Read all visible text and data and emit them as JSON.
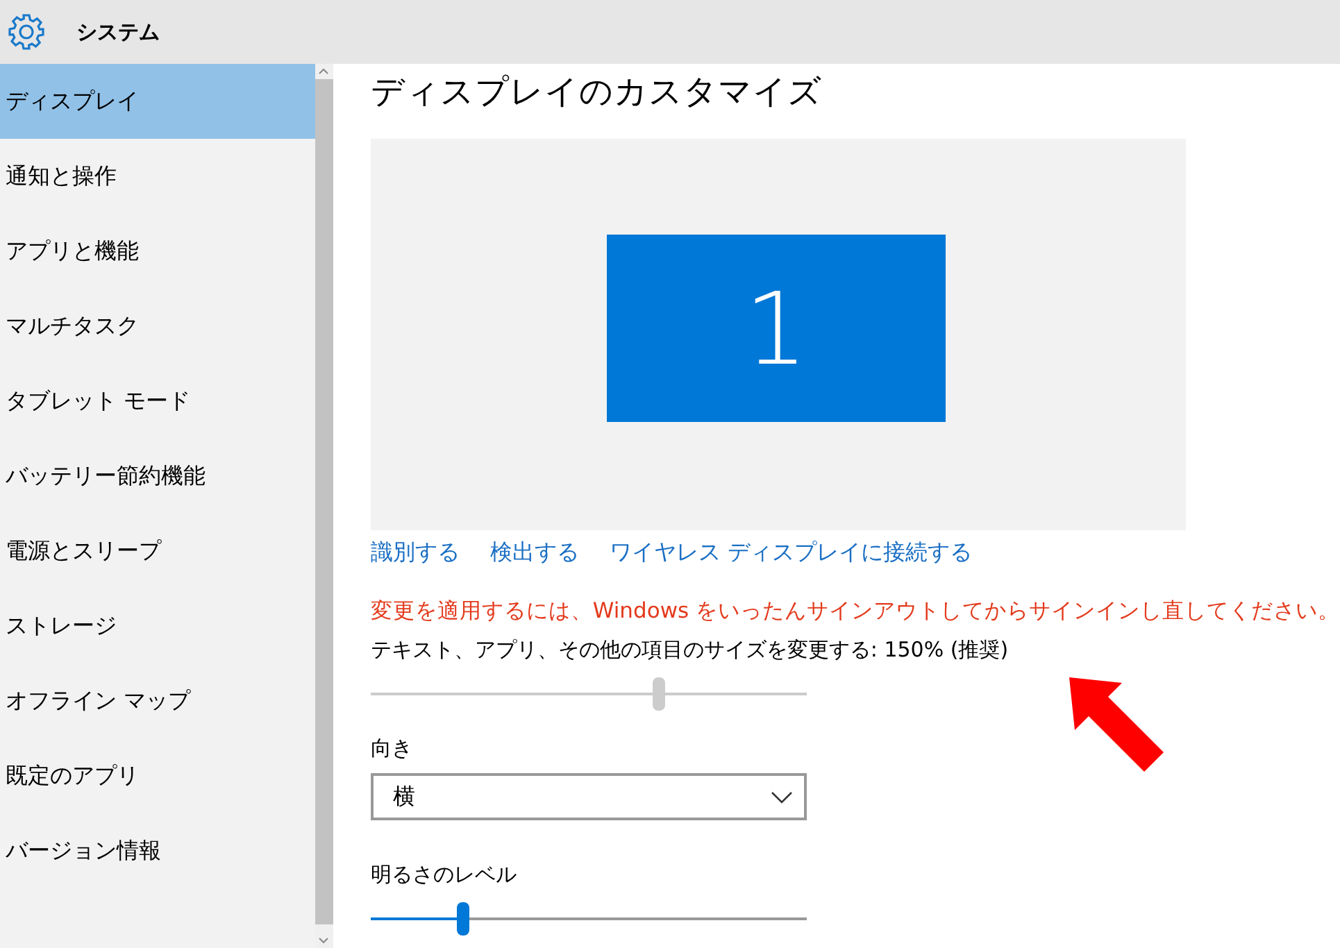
{
  "header": {
    "title": "システム"
  },
  "sidebar": {
    "items": [
      {
        "label": "ディスプレイ",
        "selected": true
      },
      {
        "label": "通知と操作",
        "selected": false
      },
      {
        "label": "アプリと機能",
        "selected": false
      },
      {
        "label": "マルチタスク",
        "selected": false
      },
      {
        "label": "タブレット モード",
        "selected": false
      },
      {
        "label": "バッテリー節約機能",
        "selected": false
      },
      {
        "label": "電源とスリープ",
        "selected": false
      },
      {
        "label": "ストレージ",
        "selected": false
      },
      {
        "label": "オフライン マップ",
        "selected": false
      },
      {
        "label": "既定のアプリ",
        "selected": false
      },
      {
        "label": "バージョン情報",
        "selected": false
      }
    ]
  },
  "content": {
    "title": "ディスプレイのカスタマイズ",
    "monitor": {
      "number": "1"
    },
    "links": [
      "識別する",
      "検出する",
      "ワイヤレス ディスプレイに接続する"
    ],
    "warning": "変更を適用するには、Windows をいったんサインアウトしてからサインインし直してください。",
    "scale": {
      "label": "テキスト、アプリ、その他の項目のサイズを変更する: 150% (推奨)",
      "level": 0.66,
      "disabled": true
    },
    "orientation": {
      "label": "向き",
      "value": "横"
    },
    "brightness": {
      "label": "明るさのレベル",
      "level": 0.21,
      "disabled": false
    }
  }
}
